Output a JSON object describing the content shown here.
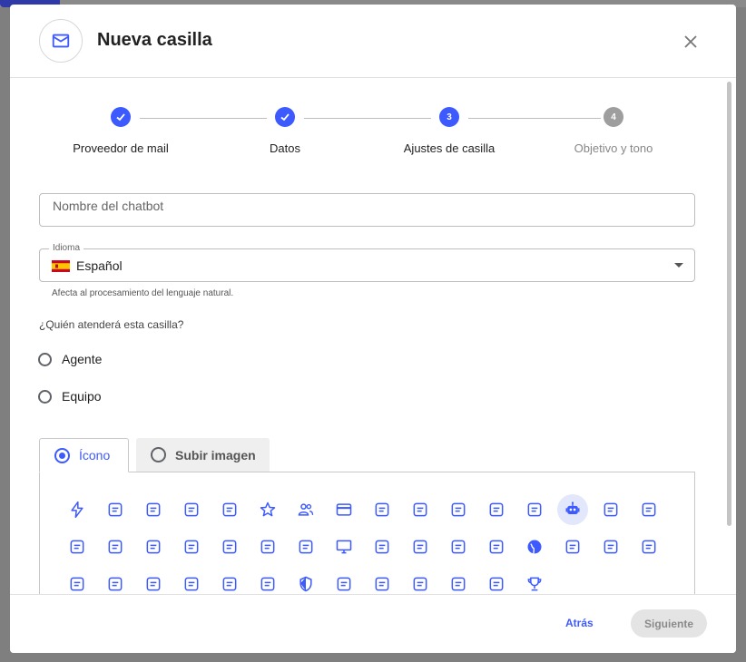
{
  "modal": {
    "title": "Nueva casilla",
    "header_icon": "mail-icon",
    "close_icon": "close-icon"
  },
  "stepper": {
    "steps": [
      {
        "label": "Proveedor de mail",
        "status": "done",
        "number": "1"
      },
      {
        "label": "Datos",
        "status": "done",
        "number": "2"
      },
      {
        "label": "Ajustes de casilla",
        "status": "active",
        "number": "3"
      },
      {
        "label": "Objetivo y tono",
        "status": "todo",
        "number": "4"
      }
    ]
  },
  "form": {
    "chatbot_name_placeholder": "Nombre del chatbot",
    "language": {
      "legend": "Idioma",
      "value": "Español",
      "flag": "spain-flag-icon",
      "helper": "Afecta al procesamiento del lenguaje natural."
    },
    "attendant": {
      "question": "¿Quién atenderá esta casilla?",
      "options": [
        "Agente",
        "Equipo"
      ]
    },
    "image_tabs": {
      "tabs": [
        "Ícono",
        "Subir imagen"
      ],
      "selected": "Ícono"
    },
    "icon_grid": {
      "selected_icon": "robot-icon",
      "icons": [
        "bolt-icon",
        "support-agent-icon",
        "receipt-icon",
        "ticket-icon",
        "campaign-icon",
        "star-icon",
        "people-icon",
        "credit-card-icon",
        "bank-icon",
        "store-icon",
        "voice-chat-icon",
        "help-bubble-icon",
        "invoice-icon",
        "robot-icon",
        "headset-icon",
        "film-icon",
        "storefront-icon",
        "van-icon",
        "restaurant-icon",
        "school-icon",
        "satellite-icon",
        "gamepad-icon",
        "person-search-icon",
        "monitor-icon",
        "science-icon",
        "medical-kit-icon",
        "photo-library-icon",
        "smile-icon",
        "globe-icon",
        "landscape-icon",
        "traffic-icon",
        "train-icon",
        "contact-card-icon",
        "music-library-icon",
        "phone-forward-icon",
        "celebration-icon",
        "heart-check-icon",
        "city-icon",
        "shield-icon",
        "brush-icon",
        "briefcase-icon",
        "chat-icon",
        "face-icon",
        "record-voice-icon",
        "trophy-icon"
      ]
    }
  },
  "footer": {
    "back_label": "Atrás",
    "next_label": "Siguiente"
  },
  "colors": {
    "accent": "#3d5afe",
    "disabled_bg": "#e4e4e4",
    "step_todo": "#9e9e9e"
  }
}
